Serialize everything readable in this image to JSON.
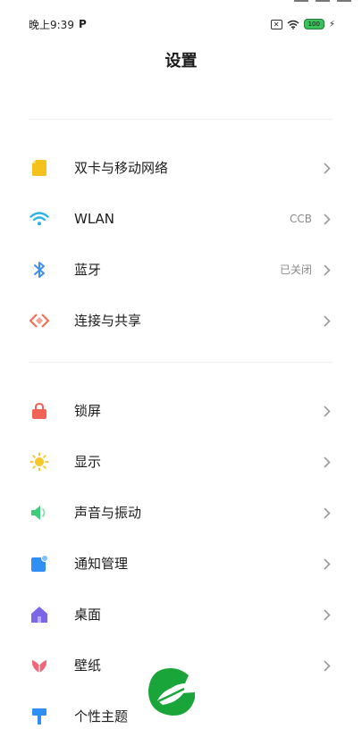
{
  "status_bar": {
    "time": "晚上9:39",
    "carrier_glyph": "P",
    "sim_glyph": "✕",
    "battery": "100",
    "icons": [
      "sim-off-icon",
      "wifi-signal-icon",
      "battery-icon",
      "charging-icon"
    ]
  },
  "page": {
    "title": "设置"
  },
  "settings": {
    "items": [
      {
        "label": "双卡与移动网络",
        "value": "",
        "icon": "sim-card-icon",
        "color": "#f5c21b"
      },
      {
        "label": "WLAN",
        "value": "CCB",
        "icon": "wifi-icon",
        "color": "#2bb3e8"
      },
      {
        "label": "蓝牙",
        "value": "已关闭",
        "icon": "bluetooth-icon",
        "color": "#3f8ef0"
      },
      {
        "label": "连接与共享",
        "value": "",
        "icon": "connection-share-icon",
        "color": "#f0705a"
      },
      {
        "label": "锁屏",
        "value": "",
        "icon": "lock-icon",
        "color": "#f26356"
      },
      {
        "label": "显示",
        "value": "",
        "icon": "sun-icon",
        "color": "#f7c82a"
      },
      {
        "label": "声音与振动",
        "value": "",
        "icon": "speaker-icon",
        "color": "#3ccc7a"
      },
      {
        "label": "通知管理",
        "value": "",
        "icon": "notification-icon",
        "color": "#2f8ff5"
      },
      {
        "label": "桌面",
        "value": "",
        "icon": "home-icon",
        "color": "#7b66e8"
      },
      {
        "label": "壁纸",
        "value": "",
        "icon": "wallpaper-icon",
        "color": "#f0677a"
      },
      {
        "label": "个性主题",
        "value": "",
        "icon": "theme-brush-icon",
        "color": "#2f8ff5"
      }
    ]
  },
  "overlay": {
    "logo_icon": "green-g-logo-icon",
    "logo_color": "#1aa53a"
  }
}
